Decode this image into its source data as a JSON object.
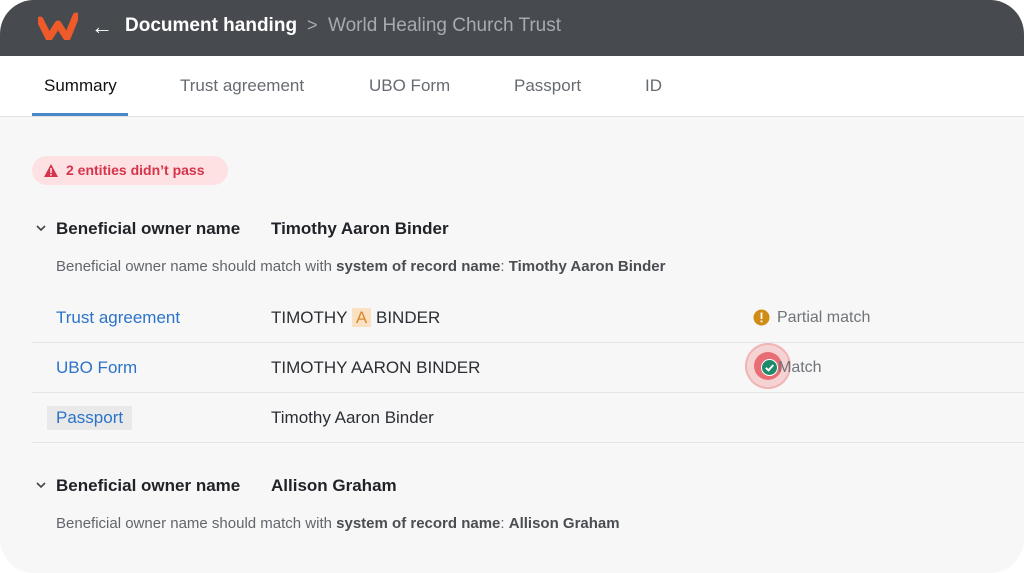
{
  "header": {
    "back_icon": "arrow-left-icon",
    "title": "Document handing",
    "separator": ">",
    "subtitle": "World Healing Church Trust",
    "logo_color": "#ef5a2a"
  },
  "tabs": [
    {
      "label": "Summary",
      "active": true
    },
    {
      "label": "Trust agreement"
    },
    {
      "label": "UBO Form"
    },
    {
      "label": "Passport"
    },
    {
      "label": "ID"
    }
  ],
  "alert": {
    "text": "2 entities didn’t pass",
    "icon": "warning-icon",
    "color": "#d6344a"
  },
  "sections": [
    {
      "label": "Beneficial owner name",
      "value": "Timothy Aaron Binder",
      "rule_prefix": "Beneficial owner name should match with ",
      "rule_bold": "system of record name",
      "rule_colon": ": ",
      "rule_value": "Timothy Aaron Binder",
      "rows": [
        {
          "doc": "Trust agreement",
          "value_pre": "TIMOTHY ",
          "value_hl": "A",
          "value_post": " BINDER",
          "status": "Partial match",
          "status_icon": "exclamation-circle-icon"
        },
        {
          "doc": "UBO Form",
          "value": "TIMOTHY AARON BINDER",
          "status": "Match",
          "status_icon": "check-circle-icon"
        },
        {
          "doc": "Passport",
          "value": "Timothy Aaron Binder"
        }
      ]
    },
    {
      "label": "Beneficial owner name",
      "value": "Allison Graham",
      "rule_prefix": "Beneficial owner name should match with ",
      "rule_bold": "system of record name",
      "rule_colon": ": ",
      "rule_value": "Allison Graham"
    }
  ],
  "colors": {
    "accent": "#4b87c8",
    "link": "#2b73c8",
    "partial": "#d08c16",
    "match": "#1a8a6a"
  }
}
